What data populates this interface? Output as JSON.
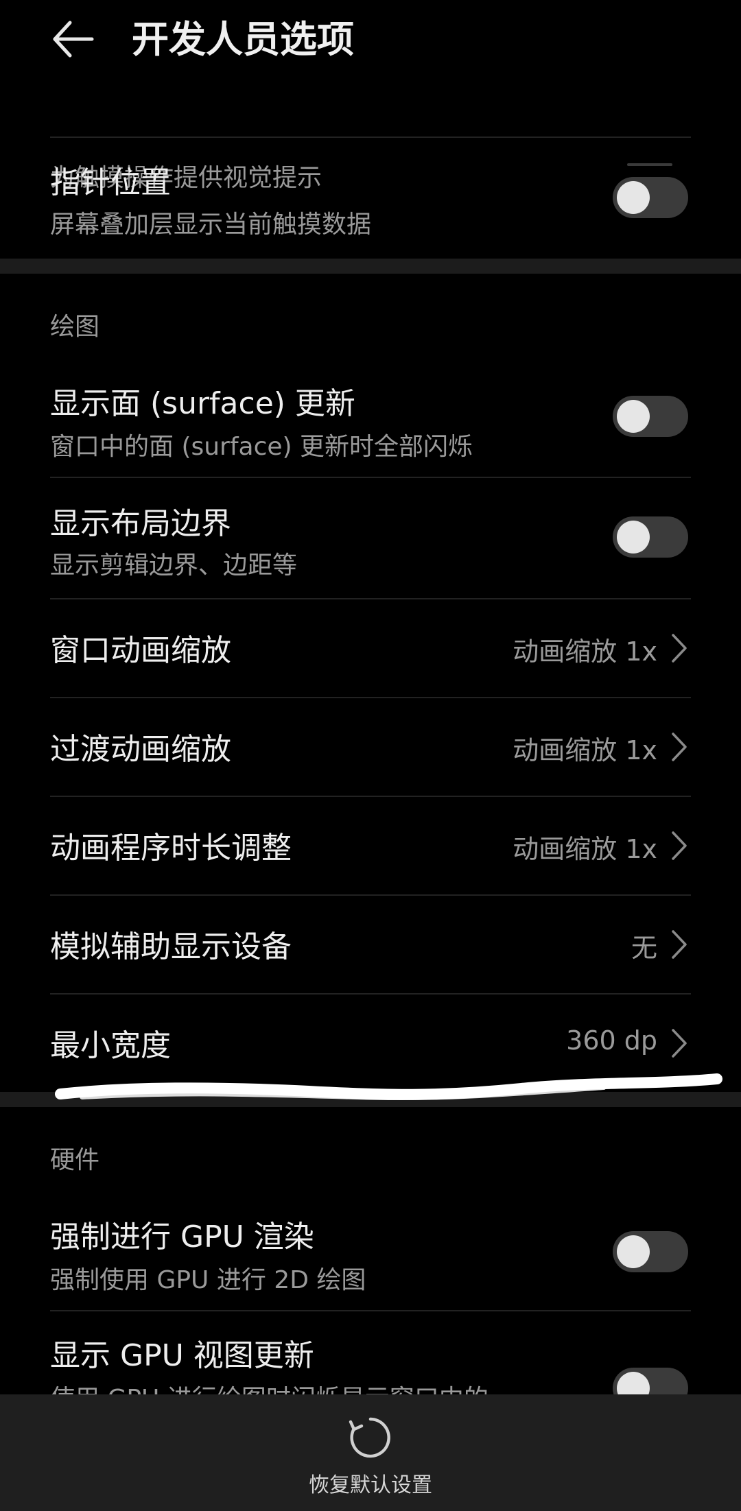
{
  "header": {
    "title": "开发人员选项"
  },
  "partial_item": {
    "subtitle": "为触摸操作提供视觉提示"
  },
  "items_top": [
    {
      "title": "指针位置",
      "subtitle": "屏幕叠加层显示当前触摸数据",
      "toggle_on": false
    }
  ],
  "sections": {
    "drawing": {
      "label": "绘图",
      "toggles": [
        {
          "title": "显示面 (surface) 更新",
          "subtitle": "窗口中的面 (surface) 更新时全部闪烁",
          "toggle_on": false
        },
        {
          "title": "显示布局边界",
          "subtitle": "显示剪辑边界、边距等",
          "toggle_on": false
        }
      ],
      "values": [
        {
          "title": "窗口动画缩放",
          "value": "动画缩放 1x"
        },
        {
          "title": "过渡动画缩放",
          "value": "动画缩放 1x"
        },
        {
          "title": "动画程序时长调整",
          "value": "动画缩放 1x"
        },
        {
          "title": "模拟辅助显示设备",
          "value": "无"
        },
        {
          "title": "最小宽度",
          "value": "360 dp"
        }
      ]
    },
    "hardware": {
      "label": "硬件",
      "toggles": [
        {
          "title": "强制进行 GPU 渲染",
          "subtitle": "强制使用 GPU 进行 2D 绘图",
          "toggle_on": false
        },
        {
          "title": "显示 GPU 视图更新",
          "subtitle": "使用 GPU 进行绘图时闪烁显示窗口中的",
          "toggle_on": false
        }
      ]
    }
  },
  "bottom_bar": {
    "reset_label": "恢复默认设置",
    "reset_icon": "refresh-icon"
  },
  "colors": {
    "background": "#000000",
    "section_gap": "#1c1c1c",
    "bottom_bar": "#1f1f1f",
    "toggle_track_off": "#3b3b3b",
    "toggle_knob": "#e6e6e6",
    "secondary_text": "#9a9a9a"
  }
}
